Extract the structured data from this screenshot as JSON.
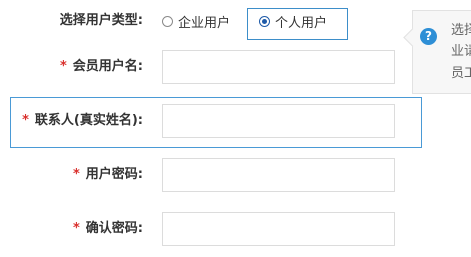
{
  "user_type": {
    "label": "选择用户类型:",
    "options": [
      {
        "label": "企业用户",
        "selected": false
      },
      {
        "label": "个人用户",
        "selected": true
      }
    ]
  },
  "fields": [
    {
      "required_mark": "*",
      "label": "会员用户名:",
      "value": "",
      "placeholder": ""
    },
    {
      "required_mark": "*",
      "label": "联系人(真实姓名):",
      "value": "",
      "placeholder": ""
    },
    {
      "required_mark": "*",
      "label": "用户密码:",
      "value": "",
      "placeholder": ""
    },
    {
      "required_mark": "*",
      "label": "确认密码:",
      "value": "",
      "placeholder": ""
    }
  ],
  "tooltip": {
    "icon": "question-icon",
    "icon_glyph": "?",
    "lines": [
      "选择",
      "业请",
      "员工"
    ]
  },
  "colors": {
    "required": "#d9302c",
    "focus_border": "#4a9ad6",
    "radio_checked": "#1e5aa8",
    "info_icon": "#2e8fd6"
  }
}
